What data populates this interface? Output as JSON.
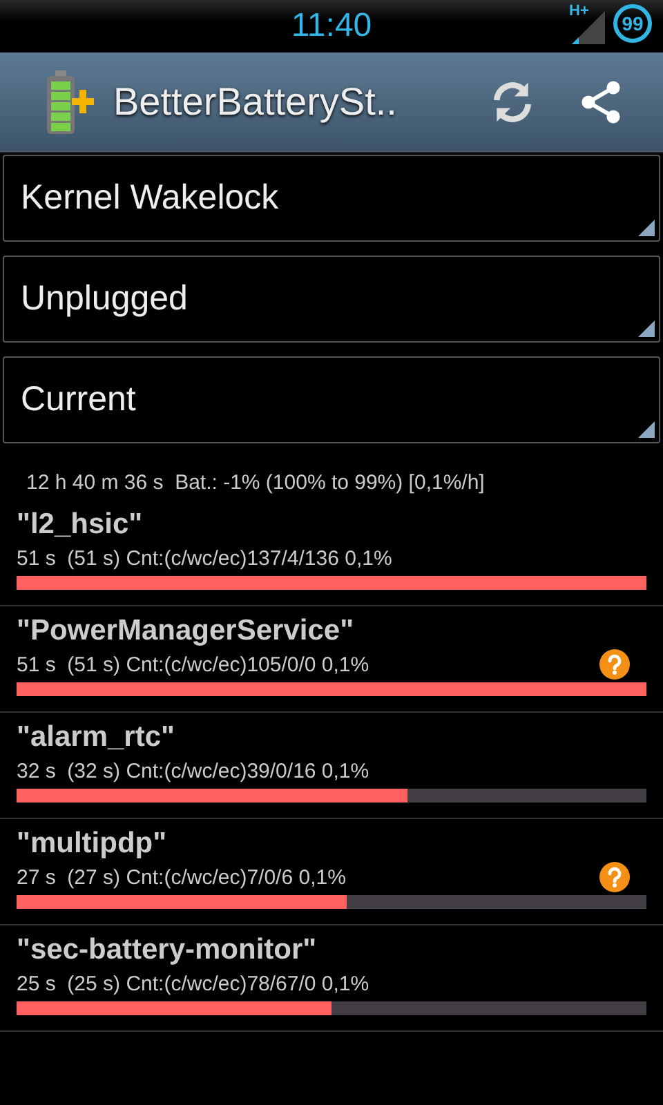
{
  "status_bar": {
    "time": "11:40",
    "network": "H+",
    "battery": "99"
  },
  "action_bar": {
    "title": "BetterBatterySt.."
  },
  "spinners": [
    {
      "value": "Kernel Wakelock"
    },
    {
      "value": "Unplugged"
    },
    {
      "value": "Current"
    }
  ],
  "summary": "12 h 40 m 36 s  Bat.: -1% (100% to 99%) [0,1%/h]",
  "wakelocks": [
    {
      "name": "\"l2_hsic\"",
      "detail": "51 s  (51 s) Cnt:(c/wc/ec)137/4/136 0,1%",
      "level": 1,
      "help_badge": false
    },
    {
      "name": "\"PowerManagerService\"",
      "detail": "51 s  (51 s) Cnt:(c/wc/ec)105/0/0 0,1%",
      "level": 1,
      "help_badge": true
    },
    {
      "name": "\"alarm_rtc\"",
      "detail": "32 s  (32 s) Cnt:(c/wc/ec)39/0/16 0,1%",
      "level": 0.62,
      "help_badge": false
    },
    {
      "name": "\"multipdp\"",
      "detail": "27 s  (27 s) Cnt:(c/wc/ec)7/0/6 0,1%",
      "level": 0.524,
      "help_badge": true
    },
    {
      "name": "\"sec-battery-monitor\"",
      "detail": "25 s  (25 s) Cnt:(c/wc/ec)78/67/0 0,1%",
      "level": 0.5,
      "help_badge": false
    }
  ]
}
